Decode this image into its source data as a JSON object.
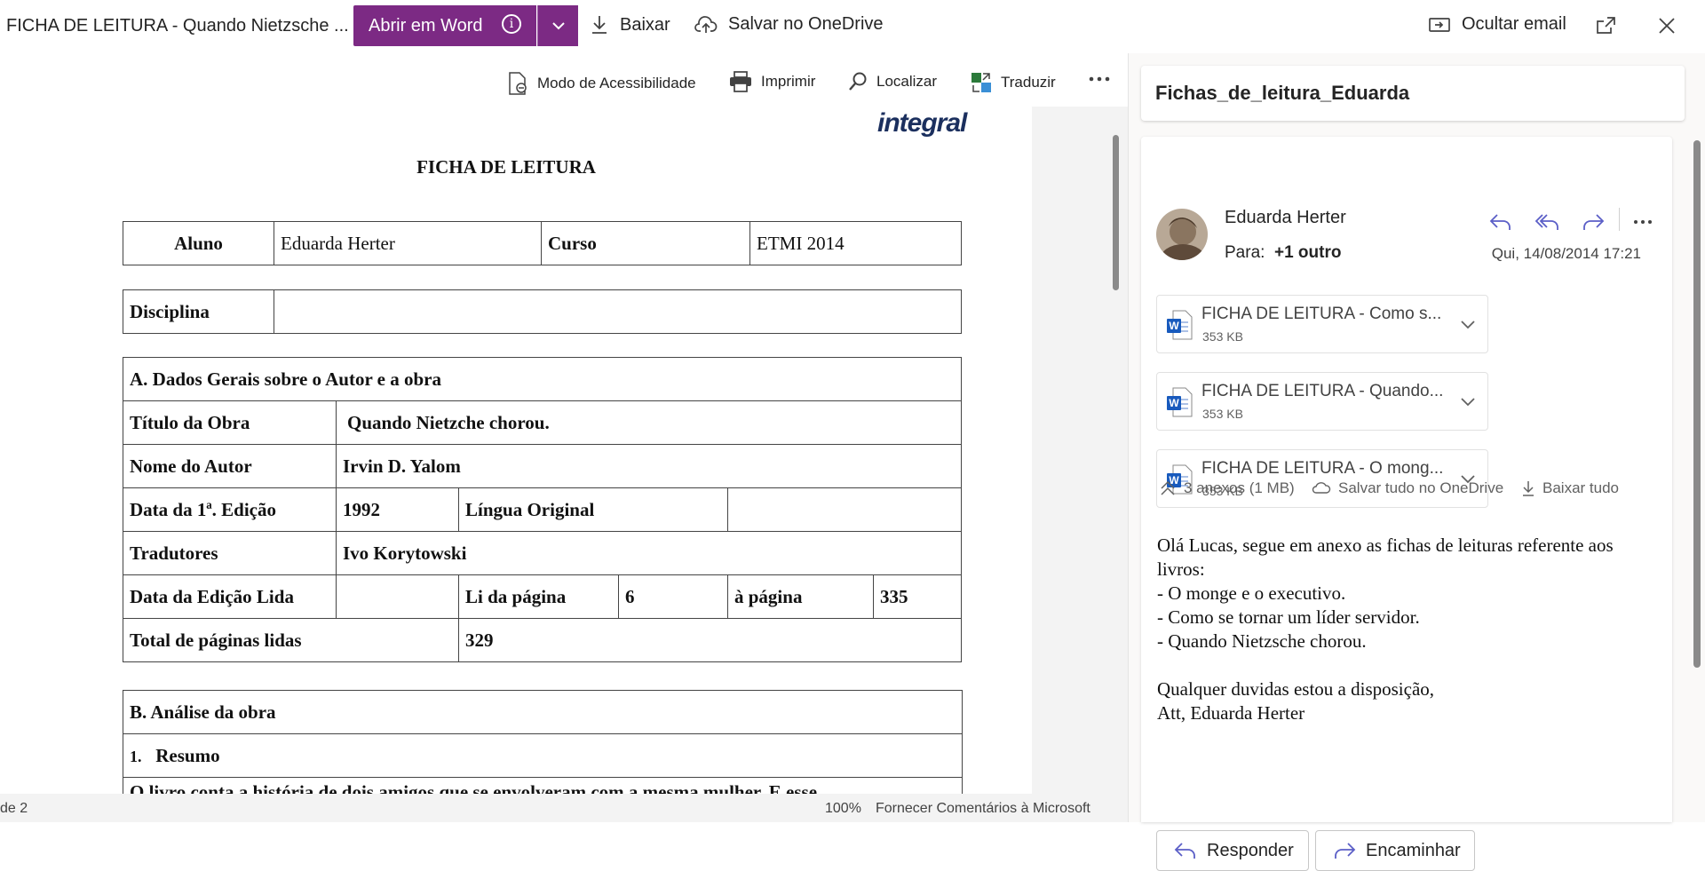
{
  "topbar": {
    "doc_title": "FICHA DE LEITURA - Quando Nietzsche ...",
    "open_word_label": "Abrir em Word",
    "download_label": "Baixar",
    "save_onedrive_label": "Salvar no OneDrive",
    "hide_email_label": "Ocultar email",
    "accent_color": "#7c2a84"
  },
  "doc_toolbar": {
    "accessibility_label": "Modo de Acessibilidade",
    "print_label": "Imprimir",
    "find_label": "Localizar",
    "translate_label": "Traduzir"
  },
  "document": {
    "logo_text": "integral",
    "heading": "FICHA DE LEITURA",
    "row1": {
      "aluno_label": "Aluno",
      "aluno_value": "Eduarda Herter",
      "curso_label": "Curso",
      "curso_value": "ETMI 2014"
    },
    "disciplina_label": "Disciplina",
    "section_a": "A.  Dados Gerais sobre o Autor e a obra",
    "titulo_label": "Título da Obra",
    "titulo_value": "Quando Nietzche chorou.",
    "autor_label": "Nome do Autor",
    "autor_value": "Irvin D. Yalom",
    "edicao_label": "Data da 1ª. Edição",
    "edicao_value": "1992",
    "lingua_label": "Língua Original",
    "tradutores_label": "Tradutores",
    "tradutores_value": "Ivo Korytowski",
    "edicao_lida_label": "Data da Edição Lida",
    "li_da_pagina_label": "Li da página",
    "li_da_pagina_value": "6",
    "a_pagina_label": "à página",
    "a_pagina_value": "335",
    "total_label": "Total de páginas lidas",
    "total_value": "329",
    "section_b": "B.  Análise da obra",
    "resumo_num": "1.",
    "resumo_label": "Resumo",
    "partial_line": "O livro conta a história de dois amigos que se envolveram com a mesma mulher. E esse"
  },
  "statusbar": {
    "page_text": "de 2",
    "zoom": "100%",
    "feedback": "Fornecer Comentários à Microsoft"
  },
  "email": {
    "subject": "Fichas_de_leitura_Eduarda",
    "sender": "Eduarda Herter",
    "to_label": "Para:",
    "to_value": "+1 outro",
    "date": "Qui, 14/08/2014 17:21",
    "attachments": [
      {
        "name": "FICHA DE LEITURA - Como s...",
        "size": "353 KB"
      },
      {
        "name": "FICHA DE LEITURA - Quando...",
        "size": "353 KB"
      },
      {
        "name": "FICHA DE LEITURA - O mong...",
        "size": "353 KB"
      }
    ],
    "attachments_summary": "3 anexos (1 MB)",
    "save_all_label": "Salvar tudo no OneDrive",
    "download_all_label": "Baixar tudo",
    "body": {
      "line1": "Olá Lucas, segue em anexo as fichas de leituras referente aos livros:",
      "line2": "- O monge e o executivo.",
      "line3": "- Como se tornar um líder servidor.",
      "line4": "- Quando Nietzsche chorou.",
      "line5": "Qualquer duvidas estou a disposição,",
      "line6": "Att, Eduarda Herter"
    },
    "reply_label": "Responder",
    "forward_label": "Encaminhar",
    "action_color": "#5b5fc7"
  }
}
